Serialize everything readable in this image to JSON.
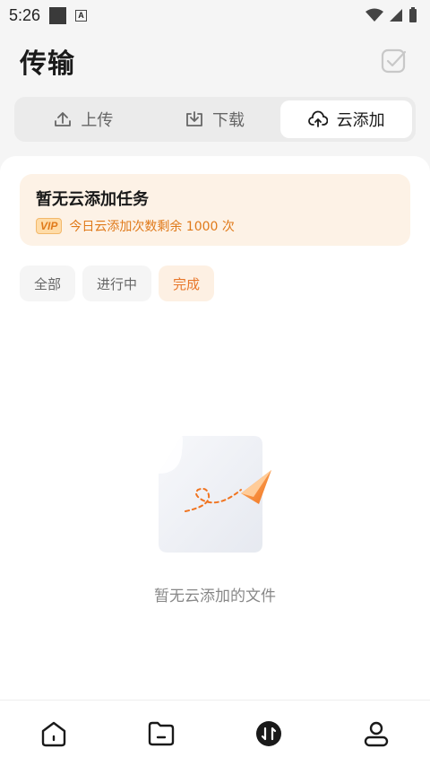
{
  "status_bar": {
    "time": "5:26",
    "notification_letter": "A"
  },
  "header": {
    "title": "传输"
  },
  "tabs": [
    {
      "label": "上传",
      "icon": "upload-icon"
    },
    {
      "label": "下载",
      "icon": "download-icon"
    },
    {
      "label": "云添加",
      "icon": "cloud-upload-icon"
    }
  ],
  "vip_card": {
    "title": "暂无云添加任务",
    "badge": "VIP",
    "quota_text": "今日云添加次数剩余 1000 次"
  },
  "filters": [
    "全部",
    "进行中",
    "完成"
  ],
  "empty_state": {
    "message": "暂无云添加的文件"
  },
  "bottom_nav": [
    {
      "icon": "home-icon"
    },
    {
      "icon": "folder-icon"
    },
    {
      "icon": "transfer-icon"
    },
    {
      "icon": "profile-icon"
    }
  ],
  "colors": {
    "accent": "#e8772a",
    "vip_bg": "#fdf2e6"
  }
}
